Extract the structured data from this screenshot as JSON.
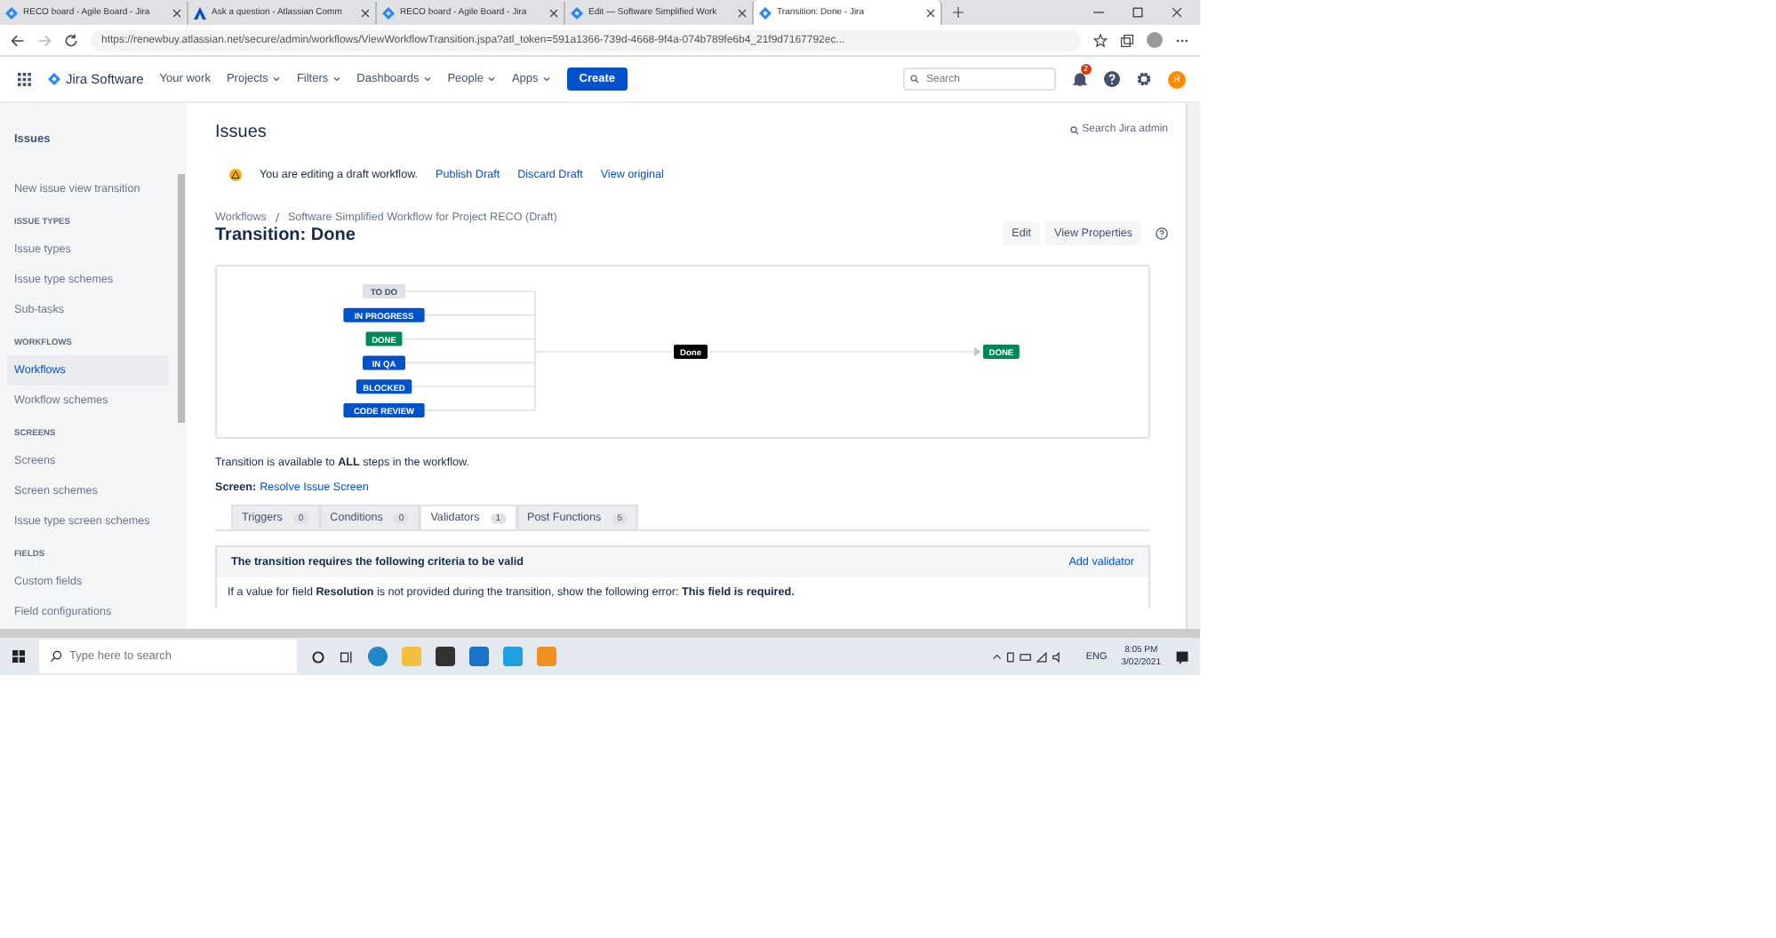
{
  "browser_tabs": [
    {
      "title": "RECO board - Agile Board - Jira",
      "selected": false
    },
    {
      "title": "Ask a question - Atlassian Comm",
      "selected": false
    },
    {
      "title": "RECO board - Agile Board - Jira",
      "selected": false
    },
    {
      "title": "Edit — Software Simplified Work",
      "selected": false
    },
    {
      "title": "Transition: Done - Jira",
      "selected": true
    }
  ],
  "address_bar": {
    "url": "https://renewbuy.atlassian.net/secure/admin/workflows/ViewWorkflowTransition.jspa?atl_token=591a1366-739d-4668-9f4a-074b789fe6b4_21f9d7167792ec..."
  },
  "app_nav": {
    "product": "Jira Software",
    "items": [
      {
        "label": "Your work",
        "dropdown": false
      },
      {
        "label": "Projects",
        "dropdown": true
      },
      {
        "label": "Filters",
        "dropdown": true
      },
      {
        "label": "Dashboards",
        "dropdown": true
      },
      {
        "label": "People",
        "dropdown": true
      },
      {
        "label": "Apps",
        "dropdown": true
      }
    ],
    "create": "Create",
    "search": {
      "placeholder": "Search"
    },
    "notification_count": "2",
    "avatar": "R"
  },
  "sidebar": {
    "title": "Issues",
    "items": [
      {
        "kind": "item",
        "label": "New issue view transition",
        "selected": false
      },
      {
        "kind": "heading",
        "label": "ISSUE TYPES"
      },
      {
        "kind": "item",
        "label": "Issue types",
        "selected": false
      },
      {
        "kind": "item",
        "label": "Issue type schemes",
        "selected": false
      },
      {
        "kind": "item",
        "label": "Sub-tasks",
        "selected": false
      },
      {
        "kind": "heading",
        "label": "WORKFLOWS"
      },
      {
        "kind": "item",
        "label": "Workflows",
        "selected": true
      },
      {
        "kind": "item",
        "label": "Workflow schemes",
        "selected": false
      },
      {
        "kind": "heading",
        "label": "SCREENS"
      },
      {
        "kind": "item",
        "label": "Screens",
        "selected": false
      },
      {
        "kind": "item",
        "label": "Screen schemes",
        "selected": false
      },
      {
        "kind": "item",
        "label": "Issue type screen schemes",
        "selected": false
      },
      {
        "kind": "heading",
        "label": "FIELDS"
      },
      {
        "kind": "item",
        "label": "Custom fields",
        "selected": false
      },
      {
        "kind": "item",
        "label": "Field configurations",
        "selected": false
      }
    ]
  },
  "main": {
    "heading": "Issues",
    "search_admin": "Search Jira admin",
    "draft_banner": {
      "message": "You are editing a draft workflow.",
      "links": [
        "Publish Draft",
        "Discard Draft",
        "View original"
      ]
    },
    "breadcrumbs": [
      "Workflows",
      "Software Simplified Workflow for Project RECO (Draft)"
    ],
    "title": "Transition: Done",
    "actions": [
      "Edit",
      "View Properties"
    ],
    "diagram": {
      "from_statuses": [
        {
          "label": "TO DO",
          "color": "#dfe1e6"
        },
        {
          "label": "IN PROGRESS",
          "color": "#0052cc"
        },
        {
          "label": "DONE",
          "color": "#00875a"
        },
        {
          "label": "IN QA",
          "color": "#0052cc"
        },
        {
          "label": "BLOCKED",
          "color": "#0052cc"
        },
        {
          "label": "CODE REVIEW",
          "color": "#0052cc"
        }
      ],
      "transition": "Done",
      "to_status": {
        "label": "DONE",
        "color": "#00875a"
      }
    },
    "availability": "Transition is available to **ALL** steps in the workflow.",
    "screen": {
      "label": "Screen:",
      "link": "Resolve Issue Screen"
    },
    "tabs": [
      {
        "label": "Triggers",
        "count": "0",
        "selected": false
      },
      {
        "label": "Conditions",
        "count": "0",
        "selected": false
      },
      {
        "label": "Validators",
        "count": "1",
        "selected": true
      },
      {
        "label": "Post Functions",
        "count": "5",
        "selected": false
      }
    ],
    "panel": {
      "heading": "The transition requires the following criteria to be valid",
      "action": "Add validator",
      "rule": "If a value for field **Resolution** is not provided during the transition, show the following error: **This field is required.**"
    }
  },
  "taskbar": {
    "search_placeholder": "Type here to search",
    "language": "ENG",
    "time": "8:05 PM",
    "date": "3/02/2021"
  }
}
